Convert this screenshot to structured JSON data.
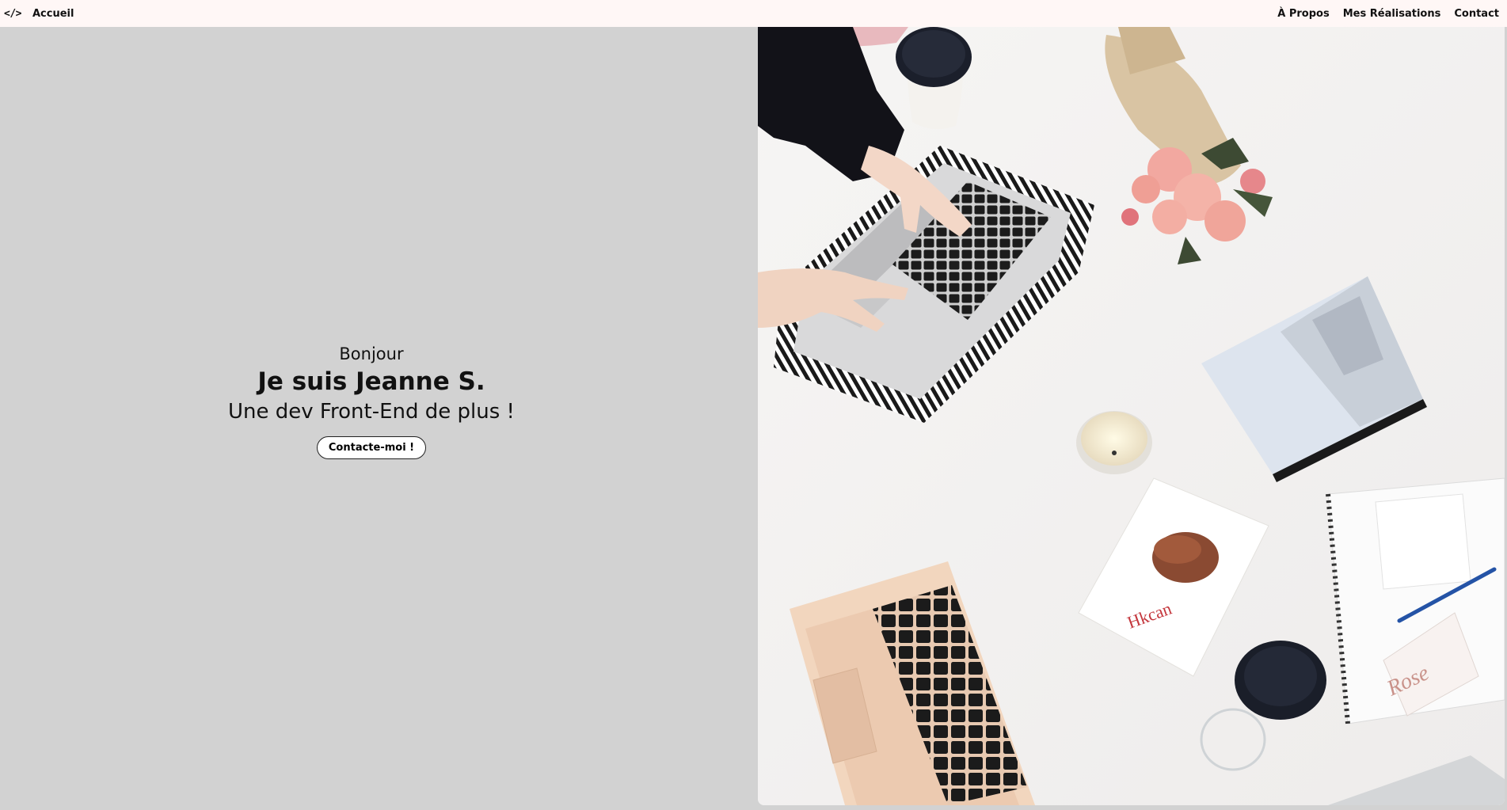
{
  "nav": {
    "logo_icon": "code-icon",
    "logo_text": "</>",
    "home_label": "Accueil",
    "links": [
      {
        "label": "À Propos"
      },
      {
        "label": "Mes Réalisations"
      },
      {
        "label": "Contact"
      }
    ]
  },
  "hero": {
    "greeting": "Bonjour",
    "name": "Je suis Jeanne S.",
    "tagline": "Une dev Front-End de plus !",
    "cta_label": "Contacte-moi !"
  },
  "colors": {
    "nav_background": "#fff7f6",
    "hero_background": "#d2d2d2"
  }
}
